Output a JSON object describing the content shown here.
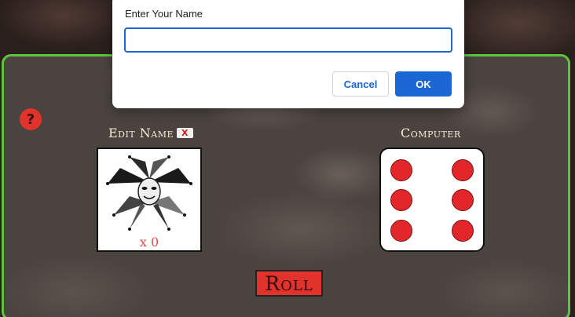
{
  "colors": {
    "board_border": "#5cc63d",
    "accent_red": "#e2322c",
    "dialog_primary": "#1a66d2",
    "label_text": "#f2ecd2"
  },
  "help": {
    "icon": "question-mark-icon",
    "glyph": "?"
  },
  "player": {
    "edit_label": "Edit Name",
    "clear_label": "X",
    "avatar_icon": "jester-icon",
    "score_text": "x 0"
  },
  "computer": {
    "label": "Computer",
    "die_value": 6
  },
  "roll": {
    "label": "Roll"
  },
  "dialog": {
    "prompt": "Enter Your Name",
    "input_value": "",
    "cancel_label": "Cancel",
    "ok_label": "OK"
  }
}
